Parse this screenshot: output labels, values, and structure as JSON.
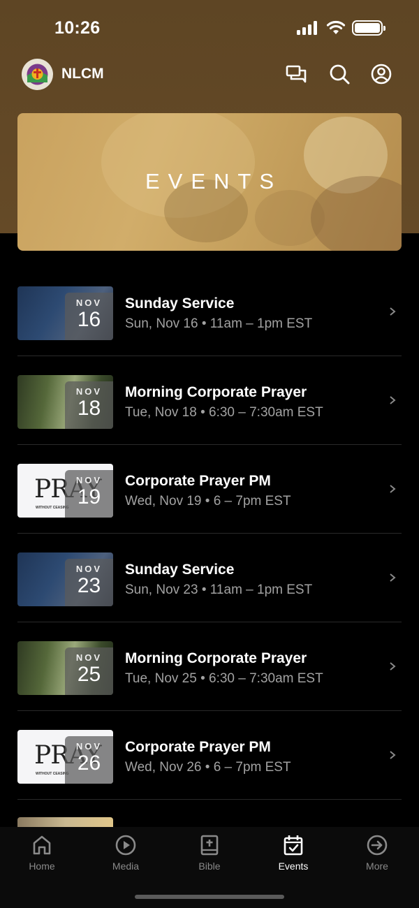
{
  "status_bar": {
    "time": "10:26"
  },
  "header": {
    "app_name": "NLCM"
  },
  "banner": {
    "title": "EVENTS"
  },
  "events": [
    {
      "title": "Sunday Service",
      "meta": "Sun, Nov 16 • 11am – 1pm EST",
      "month": "NOV",
      "day": "16",
      "thumb": "bible"
    },
    {
      "title": "Morning Corporate Prayer",
      "meta": "Tue, Nov 18 • 6:30 – 7:30am EST",
      "month": "NOV",
      "day": "18",
      "thumb": "forest"
    },
    {
      "title": "Corporate Prayer PM",
      "meta": "Wed, Nov 19 • 6 – 7pm EST",
      "month": "NOV",
      "day": "19",
      "thumb": "pray"
    },
    {
      "title": "Sunday Service",
      "meta": "Sun, Nov 23 • 11am – 1pm EST",
      "month": "NOV",
      "day": "23",
      "thumb": "bible"
    },
    {
      "title": "Morning Corporate Prayer",
      "meta": "Tue, Nov 25 • 6:30 – 7:30am EST",
      "month": "NOV",
      "day": "25",
      "thumb": "forest"
    },
    {
      "title": "Corporate Prayer PM",
      "meta": "Wed, Nov 26 • 6 – 7pm EST",
      "month": "NOV",
      "day": "26",
      "thumb": "pray"
    }
  ],
  "pray_thumb": {
    "word": "PRAY",
    "subtitle": "WITHOUT CEASING"
  },
  "tabs": [
    {
      "label": "Home",
      "icon": "home-icon",
      "active": false
    },
    {
      "label": "Media",
      "icon": "play-circle-icon",
      "active": false
    },
    {
      "label": "Bible",
      "icon": "bible-icon",
      "active": false
    },
    {
      "label": "Events",
      "icon": "calendar-check-icon",
      "active": true
    },
    {
      "label": "More",
      "icon": "arrow-circle-right-icon",
      "active": false
    }
  ],
  "colors": {
    "header_brown": "#5e4524",
    "banner_gold": "#c9a25f",
    "background": "#000000",
    "muted_text": "#a2a2a2"
  }
}
